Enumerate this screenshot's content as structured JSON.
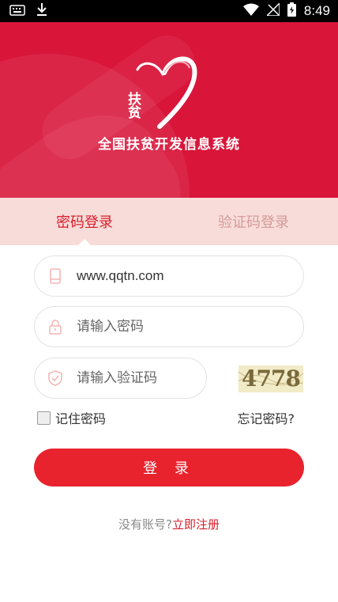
{
  "status_bar": {
    "time": "8:49",
    "icons": [
      "keyboard-icon",
      "download-icon",
      "wifi-icon",
      "no-signal-icon",
      "battery-charging-icon"
    ]
  },
  "header": {
    "logo_text": "扶贫",
    "title": "全国扶贫开发信息系统"
  },
  "tabs": [
    {
      "label": "密码登录",
      "active": true
    },
    {
      "label": "验证码登录",
      "active": false
    }
  ],
  "form": {
    "username": {
      "value": "www.qqtn.com",
      "icon": "phone-icon"
    },
    "password": {
      "placeholder": "请输入密码",
      "icon": "lock-icon"
    },
    "captcha": {
      "placeholder": "请输入验证码",
      "icon": "shield-icon",
      "image_text": "4778"
    },
    "remember_label": "记住密码",
    "forgot_label": "忘记密码?",
    "login_label": "登 录"
  },
  "register": {
    "question": "没有账号?",
    "link": "立即注册"
  },
  "colors": {
    "brand_red": "#d9153a",
    "button_red": "#e8232e",
    "tab_bg": "#f8dcd9"
  }
}
